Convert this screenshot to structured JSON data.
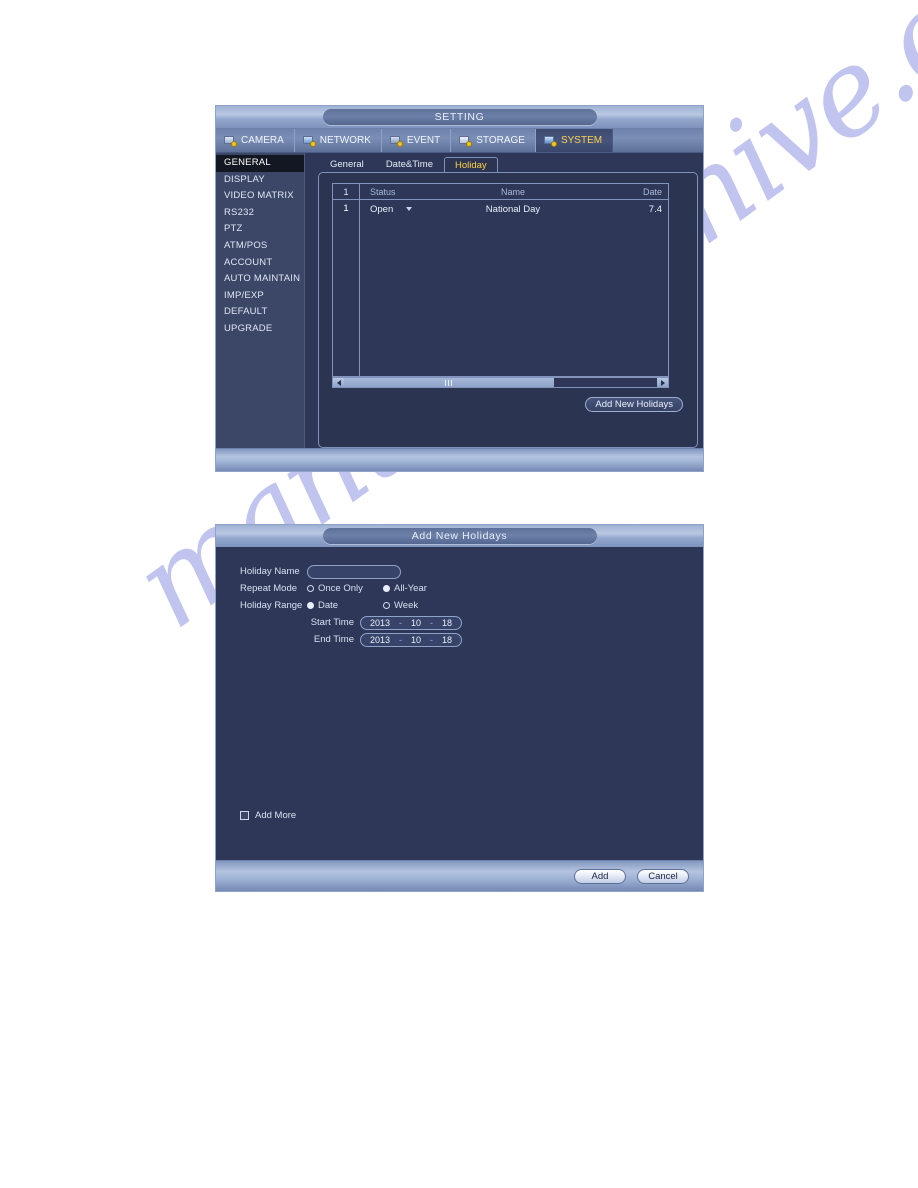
{
  "watermark": {
    "text": "manualsarchive.com",
    "color": "#6a74d8"
  },
  "setting_window": {
    "title": "SETTING",
    "menu_tabs": [
      {
        "label": "CAMERA",
        "icon": "camera-gear-icon",
        "active": false
      },
      {
        "label": "NETWORK",
        "icon": "network-gear-icon",
        "active": false
      },
      {
        "label": "EVENT",
        "icon": "event-gear-icon",
        "active": false
      },
      {
        "label": "STORAGE",
        "icon": "storage-gear-icon",
        "active": false
      },
      {
        "label": "SYSTEM",
        "icon": "system-gear-icon",
        "active": true
      }
    ],
    "sidebar": {
      "items": [
        {
          "label": "GENERAL",
          "active": true
        },
        {
          "label": "DISPLAY",
          "active": false
        },
        {
          "label": "VIDEO MATRIX",
          "active": false
        },
        {
          "label": "RS232",
          "active": false
        },
        {
          "label": "PTZ",
          "active": false
        },
        {
          "label": "ATM/POS",
          "active": false
        },
        {
          "label": "ACCOUNT",
          "active": false
        },
        {
          "label": "AUTO MAINTAIN",
          "active": false
        },
        {
          "label": "IMP/EXP",
          "active": false
        },
        {
          "label": "DEFAULT",
          "active": false
        },
        {
          "label": "UPGRADE",
          "active": false
        }
      ]
    },
    "subtabs": [
      {
        "label": "General",
        "active": false
      },
      {
        "label": "Date&Time",
        "active": false
      },
      {
        "label": "Holiday",
        "active": true
      }
    ],
    "table": {
      "headers": {
        "index": "1",
        "status": "Status",
        "name": "Name",
        "date": "Date"
      },
      "rows": [
        {
          "index": "1",
          "status": "Open",
          "name": "National Day",
          "date": "7.4"
        }
      ]
    },
    "add_new_holidays_label": "Add New Holidays"
  },
  "add_holidays_window": {
    "title": "Add New Holidays",
    "holiday_name": {
      "label": "Holiday Name",
      "value": "",
      "placeholder": ""
    },
    "repeat_mode": {
      "label": "Repeat Mode",
      "options": [
        {
          "label": "Once Only",
          "selected": false
        },
        {
          "label": "All-Year",
          "selected": true
        }
      ]
    },
    "holiday_range": {
      "label": "Holiday Range",
      "options": [
        {
          "label": "Date",
          "selected": true
        },
        {
          "label": "Week",
          "selected": false
        }
      ]
    },
    "start_time": {
      "label": "Start Time",
      "year": "2013",
      "month": "10",
      "day": "18",
      "separator": "-"
    },
    "end_time": {
      "label": "End Time",
      "year": "2013",
      "month": "10",
      "day": "18",
      "separator": "-"
    },
    "add_more": {
      "label": "Add More",
      "checked": false
    },
    "buttons": {
      "add": "Add",
      "cancel": "Cancel"
    }
  }
}
